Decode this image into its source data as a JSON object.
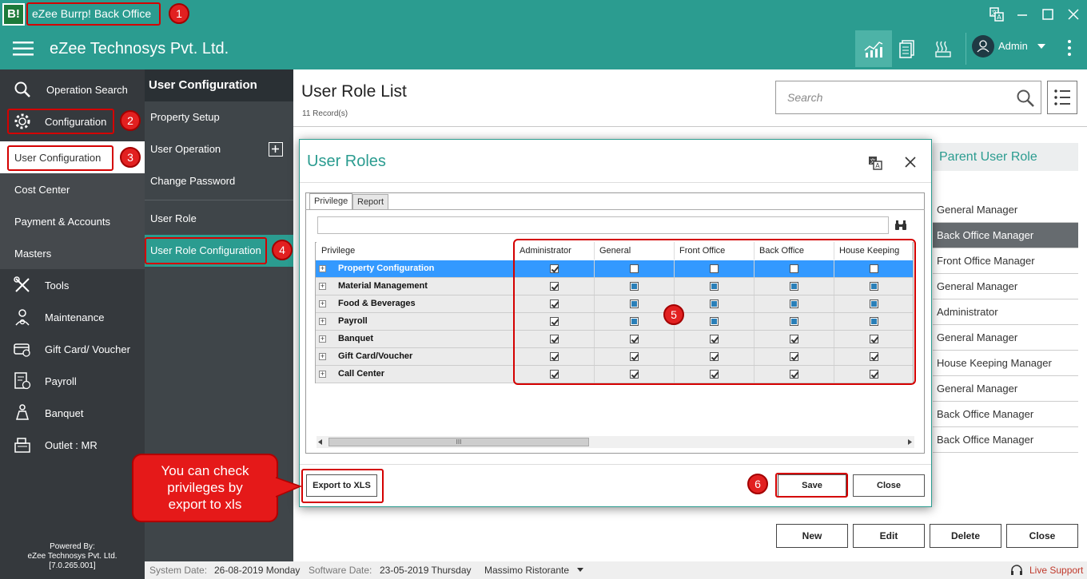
{
  "window": {
    "title": "eZee Burrp! Back Office",
    "logo": "B!"
  },
  "header": {
    "company": "eZee Technosys Pvt. Ltd.",
    "user": "Admin"
  },
  "nav": {
    "items": [
      {
        "label": "Operation Search",
        "icon": "search-icon"
      },
      {
        "label": "Configuration",
        "icon": "gear-icon"
      },
      {
        "label": "User Configuration"
      },
      {
        "label": "Cost Center"
      },
      {
        "label": "Payment & Accounts"
      },
      {
        "label": "Masters"
      },
      {
        "label": "Tools",
        "icon": "tools-icon"
      },
      {
        "label": "Maintenance",
        "icon": "maintenance-icon"
      },
      {
        "label": "Gift Card/ Voucher",
        "icon": "gift-card-icon"
      },
      {
        "label": "Payroll",
        "icon": "payroll-icon"
      },
      {
        "label": "Banquet",
        "icon": "banquet-icon"
      },
      {
        "label": "Outlet : MR",
        "icon": "outlet-icon"
      }
    ],
    "powered_by": [
      "Powered By:",
      "eZee Technosys Pvt. Ltd.",
      "[7.0.265.001]"
    ]
  },
  "submenu": {
    "title": "User Configuration",
    "items": [
      "Property Setup",
      "User Operation",
      "Change Password",
      "User Role",
      "User Role Configuration"
    ]
  },
  "main": {
    "title": "User Role List",
    "records": "11 Record(s)",
    "search_placeholder": "Search",
    "parent_header": "Parent User Role",
    "parent_roles": [
      "General Manager",
      "Back Office Manager",
      "Front Office Manager",
      "General Manager",
      "Administrator",
      "General Manager",
      "House Keeping Manager",
      "General Manager",
      "Back Office Manager",
      "Back Office Manager"
    ],
    "buttons": {
      "new": "New",
      "edit": "Edit",
      "delete": "Delete",
      "close": "Close"
    }
  },
  "modal": {
    "title": "User Roles",
    "tabs": [
      "Privilege",
      "Report"
    ],
    "columns": [
      "Privilege",
      "Administrator",
      "General",
      "Front Office",
      "Back Office",
      "House Keeping"
    ],
    "rows": [
      {
        "name": "Property Configuration",
        "states": [
          "on",
          "off",
          "off",
          "off",
          "off"
        ]
      },
      {
        "name": "Material Management",
        "states": [
          "on",
          "ind",
          "ind",
          "ind",
          "ind"
        ]
      },
      {
        "name": "Food & Beverages",
        "states": [
          "on",
          "ind",
          "ind",
          "ind",
          "ind"
        ]
      },
      {
        "name": "Payroll",
        "states": [
          "on",
          "ind",
          "ind",
          "ind",
          "ind"
        ]
      },
      {
        "name": "Banquet",
        "states": [
          "on",
          "on",
          "on",
          "on",
          "on"
        ]
      },
      {
        "name": "Gift Card/Voucher",
        "states": [
          "on",
          "on",
          "on",
          "on",
          "on"
        ]
      },
      {
        "name": "Call Center",
        "states": [
          "on",
          "on",
          "on",
          "on",
          "on"
        ]
      }
    ],
    "export_label": "Export to XLS",
    "save_label": "Save",
    "close_label": "Close",
    "scroll_grip": "III"
  },
  "annotations": {
    "steps": [
      "1",
      "2",
      "3",
      "4",
      "5",
      "6"
    ],
    "callout": [
      "You can check",
      "privileges by",
      "export to xls"
    ]
  },
  "status": {
    "system_date_label": "System Date:",
    "system_date": "26-08-2019 Monday",
    "software_date_label": "Software Date:",
    "software_date": "23-05-2019 Thursday",
    "outlet": "Massimo Ristorante",
    "live_support": "Live Support"
  },
  "colors": {
    "teal": "#2b9c90",
    "nav_bg": "#35393d",
    "annotation_red": "#e22020"
  }
}
